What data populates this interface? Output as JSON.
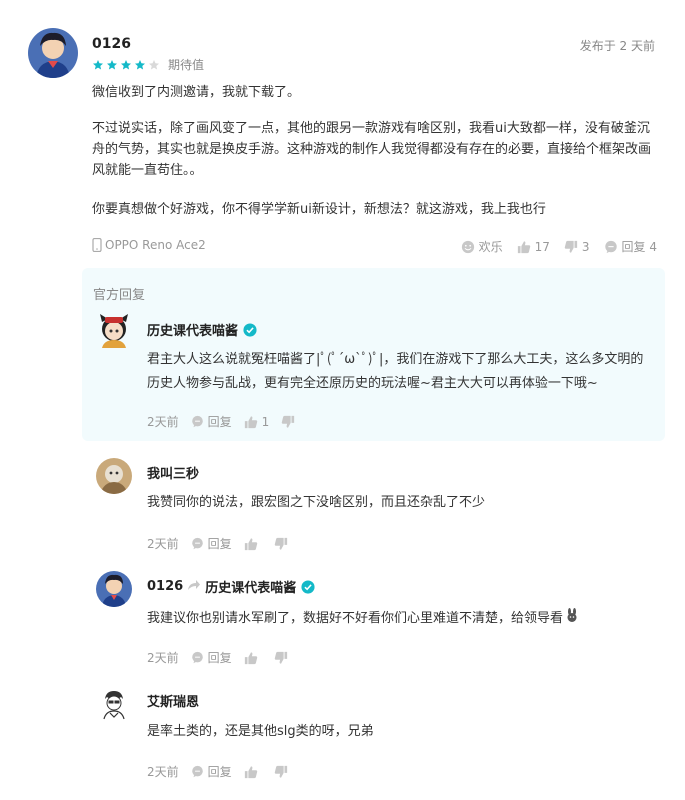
{
  "review": {
    "username": "0126",
    "date": "发布于 2 天前",
    "rating": 4,
    "rating_max": 5,
    "rating_label": "期待值",
    "paragraphs": [
      "微信收到了内测邀请，我就下载了。",
      "不过说实话，除了画风变了一点，其他的跟另一款游戏有啥区别，我看ui大致都一样，没有破釜沉舟的气势，其实也就是换皮手游。这种游戏的制作人我觉得都没有存在的必要，直接给个框架改画风就能一直苟住。。",
      "你要真想做个好游戏，你不得学学新ui新设计，新想法？就这游戏，我上我也行"
    ],
    "device": "OPPO Reno Ace2",
    "actions": {
      "joy_label": "欢乐",
      "likes": "17",
      "dislikes": "3",
      "reply_label": "回复 4"
    }
  },
  "official_reply": {
    "section_title": "官方回复",
    "author": "历史课代表喵酱",
    "text": "君主大人这么说就冤枉喵酱了|ﾟ(ﾟ´ω`ﾟ)ﾟ|，我们在游戏下了那么大工夫，这么多文明的历史人物参与乱战，更有完全还原历史的玩法喔~君主大大可以再体验一下哦~",
    "time": "2天前",
    "reply_label": "回复",
    "likes": "1"
  },
  "replies": [
    {
      "author": "我叫三秒",
      "reply_to": "",
      "text": "我赞同你的说法，跟宏图之下没啥区别，而且还杂乱了不少",
      "time": "2天前",
      "reply_label": "回复"
    },
    {
      "author": "0126",
      "reply_to": "历史课代表喵酱",
      "text": "我建议你也别请水军刷了，数据好不好看你们心里难道不清楚，给领导看",
      "time": "2天前",
      "reply_label": "回复"
    },
    {
      "author": "艾斯瑞恩",
      "reply_to": "",
      "text": "是率土类的，还是其他slg类的呀，兄弟",
      "time": "2天前",
      "reply_label": "回复"
    }
  ],
  "colors": {
    "star": "#14b9c8",
    "star_empty": "#d9d9d9",
    "verified": "#14b9c8",
    "official_bg": "#f2fbfd",
    "meta_gray": "#999999"
  }
}
